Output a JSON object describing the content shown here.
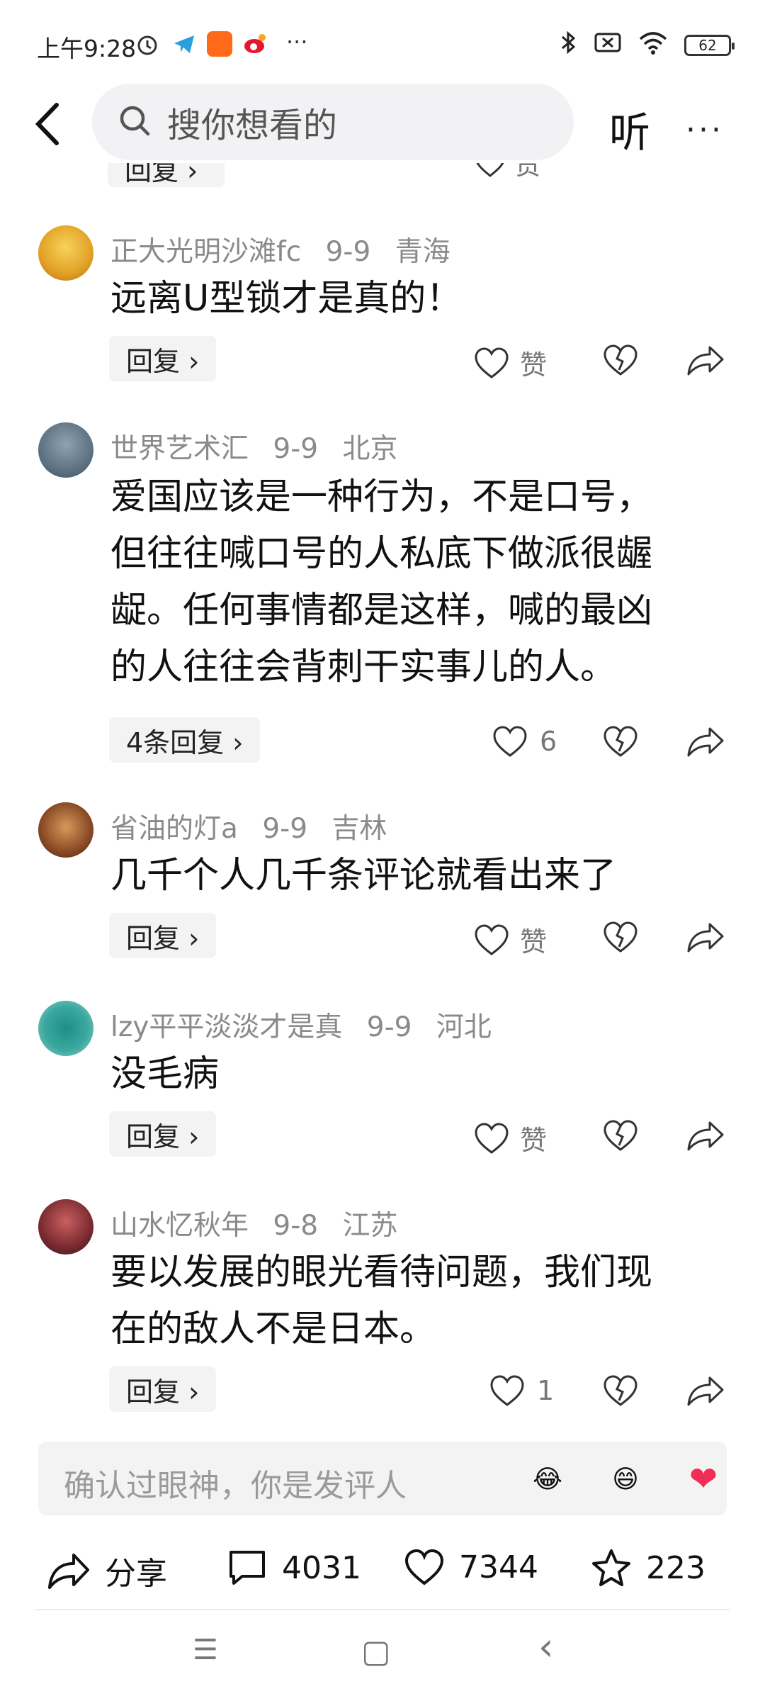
{
  "status": {
    "time": "上午9:28",
    "more": "···",
    "battery": "62"
  },
  "search": {
    "placeholder": "搜你想看的",
    "listen": "听",
    "more": "···"
  },
  "partial_row": {
    "reply": "回复 ›",
    "like": "赞"
  },
  "comments": [
    {
      "user": "正大光明沙滩fc",
      "date": "9-9",
      "region": "青海",
      "text": [
        "远离U型锁才是真的！"
      ],
      "reply": "回复 ›",
      "likes": "赞"
    },
    {
      "user": "世界艺术汇",
      "date": "9-9",
      "region": "北京",
      "text": [
        "爱国应该是一种行为，不是口号，",
        "但往往喊口号的人私底下做派很龌",
        "龊。任何事情都是这样，喊的最凶",
        "的人往往会背刺干实事儿的人。"
      ],
      "reply": "4条回复 ›",
      "likes": "6"
    },
    {
      "user": "省油的灯a",
      "date": "9-9",
      "region": "吉林",
      "text": [
        "几千个人几千条评论就看出来了"
      ],
      "reply": "回复 ›",
      "likes": "赞"
    },
    {
      "user": "lzy平平淡淡才是真",
      "date": "9-9",
      "region": "河北",
      "text": [
        "没毛病"
      ],
      "reply": "回复 ›",
      "likes": "赞"
    },
    {
      "user": "山水忆秋年",
      "date": "9-8",
      "region": "江苏",
      "text": [
        "要以发展的眼光看待问题，我们现",
        "在的敌人不是日本。"
      ],
      "reply": "回复 ›",
      "likes": "1"
    }
  ],
  "input": {
    "placeholder": "确认过眼神，你是发评人",
    "emojis": [
      "😂",
      "😄",
      "❤"
    ]
  },
  "bottom": {
    "share": "分享",
    "comments": "4031",
    "likes": "7344",
    "favorites": "223"
  },
  "nav": {
    "menu": "☰",
    "home": "▢",
    "back": "‹"
  }
}
